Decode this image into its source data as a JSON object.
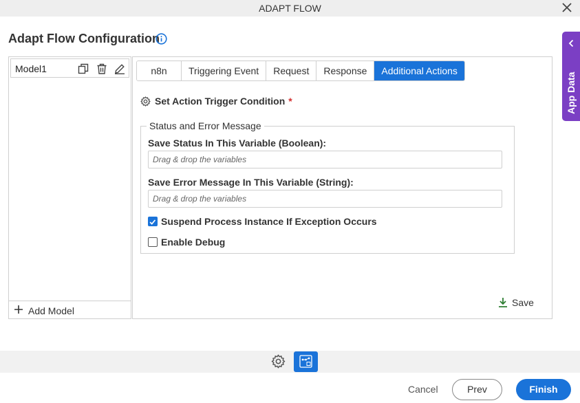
{
  "window": {
    "title": "ADAPT FLOW"
  },
  "page": {
    "heading": "Adapt Flow Configuration"
  },
  "models": {
    "items": [
      "Model1"
    ],
    "add_label": "Add Model"
  },
  "tabs": [
    {
      "label": "n8n",
      "active": false
    },
    {
      "label": "Triggering Event",
      "active": false
    },
    {
      "label": "Request",
      "active": false
    },
    {
      "label": "Response",
      "active": false
    },
    {
      "label": "Additional Actions",
      "active": true
    }
  ],
  "trigger": {
    "label": "Set Action Trigger Condition",
    "required_mark": "*"
  },
  "status_group": {
    "legend": "Status and Error Message",
    "status_label": "Save Status In This Variable (Boolean):",
    "status_placeholder": "Drag & drop the variables",
    "error_label": "Save Error Message In This Variable (String):",
    "error_placeholder": "Drag & drop the variables"
  },
  "options": {
    "suspend": {
      "label": "Suspend Process Instance If Exception Occurs",
      "checked": true
    },
    "debug": {
      "label": "Enable Debug",
      "checked": false
    }
  },
  "save_label": "Save",
  "app_data_label": "App Data",
  "footer": {
    "cancel": "Cancel",
    "prev": "Prev",
    "finish": "Finish"
  },
  "colors": {
    "accent": "#1a73d9",
    "app_data": "#7b3fc4",
    "required": "#d32f2f",
    "save_icon": "#2e7d32"
  },
  "icons": [
    "close-icon",
    "info-icon",
    "copy-icon",
    "trash-icon",
    "edit-icon",
    "plus-icon",
    "gear-icon",
    "download-icon",
    "chevron-left-icon",
    "flow-icon"
  ]
}
